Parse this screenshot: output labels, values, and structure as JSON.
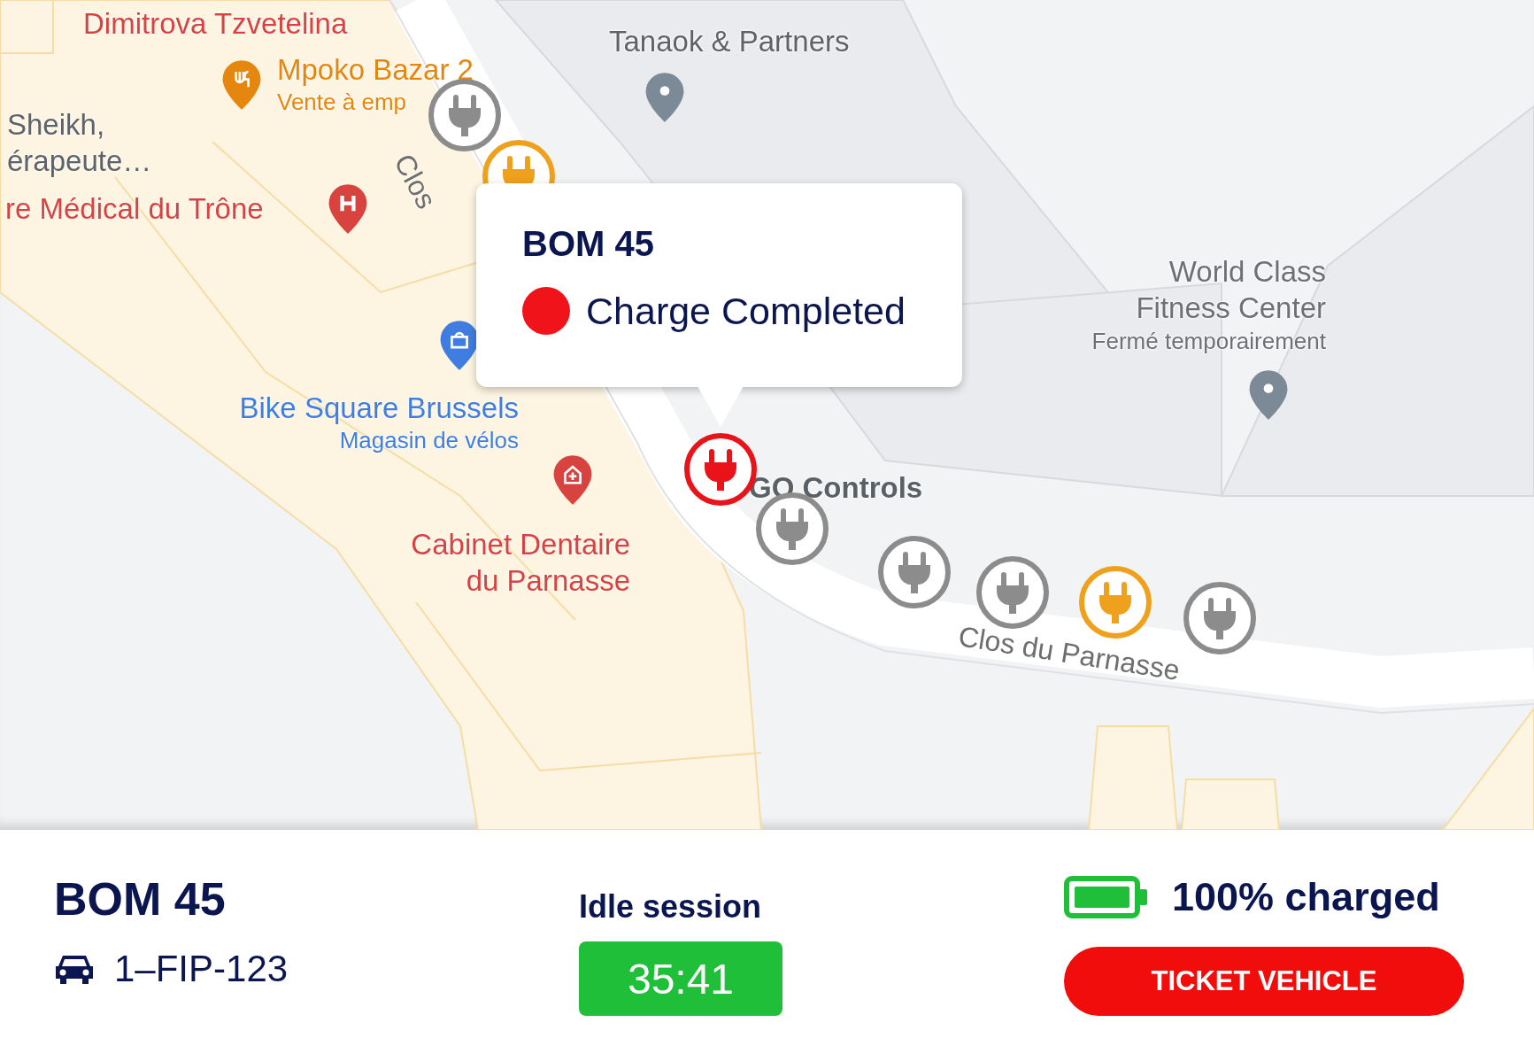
{
  "map": {
    "places": [
      {
        "color": "#d9433f",
        "lines": [
          "Dimitrova Tzvetelina"
        ]
      },
      {
        "kind": "restaurant",
        "color": "#e5870f",
        "lines": [
          "Mpoko Bazar 2"
        ],
        "note": "Vente à emp"
      },
      {
        "color": "#5f6368",
        "lines": [
          "Sheikh,",
          "érapeute…"
        ]
      },
      {
        "kind": "hospital",
        "color": "#d9433f",
        "lines": [
          "re Médical du Trône"
        ]
      },
      {
        "kind": "place",
        "color": "#5f6368",
        "lines": [
          "Tanaok & Partners"
        ]
      },
      {
        "kind": "shop",
        "color": "#3f7ee0",
        "lines": [
          "Bike Square Brussels"
        ],
        "note": "Magasin de vélos"
      },
      {
        "kind": "dentist",
        "color": "#d9433f",
        "lines": [
          "Cabinet Dentaire",
          "du Parnasse"
        ]
      },
      {
        "kind": "place",
        "color": "#6d7175",
        "lines": [
          "World Class",
          "Fitness Center"
        ],
        "note": "Fermé temporairement"
      },
      {
        "color": "#5a6166",
        "lines": [
          "GO Controls"
        ]
      }
    ],
    "roads": [
      "Clos",
      "Clos du Parnasse"
    ],
    "markers": [
      {
        "color": "#8c8c8c"
      },
      {
        "color": "#efa11d"
      },
      {
        "color": "#e8141a"
      },
      {
        "color": "#8c8c8c"
      },
      {
        "color": "#8c8c8c"
      },
      {
        "color": "#8c8c8c"
      },
      {
        "color": "#efa11d"
      },
      {
        "color": "#8c8c8c"
      }
    ],
    "popup": {
      "title": "BOM 45",
      "status": "Charge Completed",
      "color": "#f0141a"
    }
  },
  "vehicle": {
    "name": "BOM 45",
    "plate": "1–FIP-123"
  },
  "session": {
    "label": "Idle session",
    "timer": "35:41"
  },
  "charge": {
    "label": "100% charged",
    "action": "TICKET VEHICLE"
  }
}
